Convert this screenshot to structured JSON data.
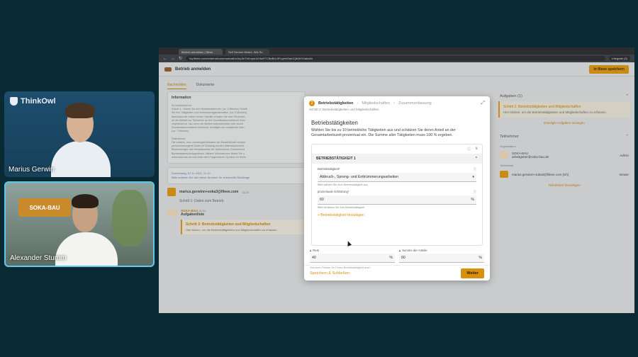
{
  "participants": {
    "tile1": {
      "logo": "ThinkOwl",
      "name": "Marius Gerwin"
    },
    "tile2": {
      "sign": "SOKA-BAU",
      "name": "Alexander Stumm"
    }
  },
  "browser": {
    "tabs": [
      "Betrieb anmelden | fileee",
      "Self Service Modul- Wie Sc"
    ],
    "url": "my.fileee.com/external/communication/eyJleTkKnqmJxViwKYCBaBoL0FryyenSan1Qlb0rVlJakzAh",
    "integrate": "Integrate (3)"
  },
  "app": {
    "title": "Betrieb anmelden",
    "open_button": "In fileee speichern",
    "tabs": [
      "Nachrichten",
      "Dokumente"
    ]
  },
  "messages": {
    "info_title": "Information",
    "info_text": [
      "So funktioniert es:",
      "Schritt 1 - Geben Sie Ihre Betriebsdaten ein. (ca. 3 Minuten) Schritt",
      "Sie Ihre Tätigkeiten und Verbandsmitgliedschaften. (ca. 5 Minuten)",
      "Abschluss der ersten beiden Schritte erhalten Sie eine Rückmeld",
      "ob der Betrieb zur Teilnahme an den Sozialkassenverfahren beim",
      "verpflichtet ist. Nur wenn der Betrieb wahrscheinlich oder sicher",
      "Sozialkassenverfahren teilnimmt, benötigen wir zusätzliche Dato",
      "(ca. 7 Minuten)",
      "",
      "Datenschutz",
      "Die Urlaubs- und Lohnausgleichskasse der Bauwirtschaft verarbe",
      "personenbezogene Daten im Einklang mit den datenschutzrecht",
      "Bestimmungen wie beispielsweise der Datenschutz-Grundverord",
      "Bundesdatenschutzgesetzes. Nähere Informationen finden Sie u",
      "www.soka-bau.de und unter dem Fragezeichen-Symbol. Im Nichh"
    ],
    "date_line": "Donnerstag, 07.11.2024, 11:19",
    "date_text": "Bitte notieren Sie sich diese Nummer für eventuelle Rückfrage",
    "user": "marius.gerwinn+soka3@fileee.com",
    "user_time": "11:21",
    "user_step": "Schritt 1: Daten zum Betrieb",
    "soka_name": "SOKA-BAU",
    "soka_time": "11:21",
    "aufg_label": "Aufgabenliste",
    "task_title": "Schritt 2: Betriebstätigkeiten und Mitgliedschaften",
    "task_desc": "Hier klicken, um die Betriebstätigkeiten und Mitgliedschaften zu erfassen."
  },
  "side": {
    "tasks_head": "Aufgaben (1)",
    "task_title": "Schritt 2: Betriebstätigkeiten und Mitgliedschaften",
    "task_desc": "Hier klicken, um die Betriebstätigkeiten und Mitgliedschaften zu erfassen.",
    "done_link": "Erledigte Aufgaben anzeigen",
    "part_head": "Teilnehmer",
    "org_label": "Organisation",
    "org_name": "SOKA-BAU",
    "org_email": "arbeitgeber@soka-bau.de",
    "org_role": "Admin",
    "ind_label": "Teilnehmer",
    "ind_email": "marius.gerwinn+soka3@fileee.com (ich)",
    "ind_role": "Viewer",
    "add_part": "Teilnehmer hinzufügen"
  },
  "modal": {
    "steps": [
      "Betriebstätigkeiten",
      "Mitgliedschaften",
      "Zusammenfassung"
    ],
    "step_index": "2",
    "subtitle": "Schritt 2: Betriebstätigkeiten und Mitgliedschaften",
    "title": "Betriebstätigkeiten",
    "description": "Wählen Sie bis zu 10 betriebliche Tätigkeiten aus und schätzen Sie deren Anteil an der Gesamtarbeitszeit prozentual ein. Die Summe aller Tätigkeiten muss 100 % ergeben.",
    "section_title": "BETRIEBSTÄTIGKEIT 1",
    "field1_label": "Betriebstätigkeit*",
    "field1_value": "Abbruch-, Spreng- und Enttrümmerungsarbeiten",
    "field1_hint": "Bitte wählen Sie eine Betriebstätigkeit aus",
    "field2_label": "prozentuale Schätzung*",
    "field2_value": "60",
    "field2_unit": "%",
    "field2_hint": "Bitte schätzen Sie Ihre Betriebstätigkeit",
    "add_activity": "+ Betriebstätigkeit hinzufügen",
    "rest_label": "Rest",
    "rest_value": "40",
    "sum_label": "Summe der Anteile",
    "sum_value": "60",
    "percent": "%",
    "ghost_text": "Gehören Filialen Ihr Firma Betriebstätigkeit aus?",
    "save_close": "Speichern & Schließen",
    "next": "Weiter"
  }
}
